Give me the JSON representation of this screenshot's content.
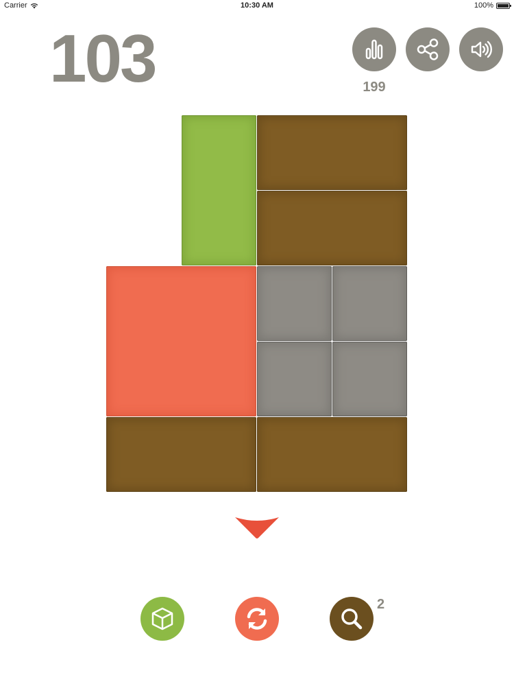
{
  "status_bar": {
    "carrier": "Carrier",
    "time": "10:30 AM",
    "battery": "100%",
    "battery_level": 1.0
  },
  "score": "103",
  "header_buttons": {
    "stats_icon": "bar-chart-icon",
    "share_icon": "share-icon",
    "sound_icon": "speaker-icon",
    "stats_count": "199"
  },
  "board": {
    "tiles": [
      {
        "color": "green",
        "col": 1,
        "row": 0,
        "w": 1,
        "h": 2
      },
      {
        "color": "brown",
        "col": 2,
        "row": 0,
        "w": 2,
        "h": 1
      },
      {
        "color": "brown",
        "col": 2,
        "row": 1,
        "w": 2,
        "h": 1
      },
      {
        "color": "red",
        "col": 0,
        "row": 2,
        "w": 2,
        "h": 2
      },
      {
        "color": "grey",
        "col": 2,
        "row": 2,
        "w": 1,
        "h": 1
      },
      {
        "color": "grey",
        "col": 3,
        "row": 2,
        "w": 1,
        "h": 1
      },
      {
        "color": "grey",
        "col": 2,
        "row": 3,
        "w": 1,
        "h": 1
      },
      {
        "color": "grey",
        "col": 3,
        "row": 3,
        "w": 1,
        "h": 1
      },
      {
        "color": "brown",
        "col": 0,
        "row": 4,
        "w": 2,
        "h": 1
      },
      {
        "color": "brown",
        "col": 2,
        "row": 4,
        "w": 2,
        "h": 1
      }
    ],
    "columns": 4,
    "rows": 5
  },
  "arrow": {
    "icon": "chevron-down-icon",
    "color": "#e8503a"
  },
  "bottom_buttons": {
    "cube": {
      "icon": "cube-icon",
      "color": "#8dba45"
    },
    "restart": {
      "icon": "refresh-icon",
      "color": "#f06c50"
    },
    "hint": {
      "icon": "magnifier-icon",
      "color": "#6b4f1f",
      "count": "2"
    }
  },
  "colors": {
    "grey_button": "#8c8a82",
    "brown": "#7f5c24",
    "green": "#92bb48",
    "red": "#f06c50",
    "grey_tile": "#8e8b85"
  }
}
